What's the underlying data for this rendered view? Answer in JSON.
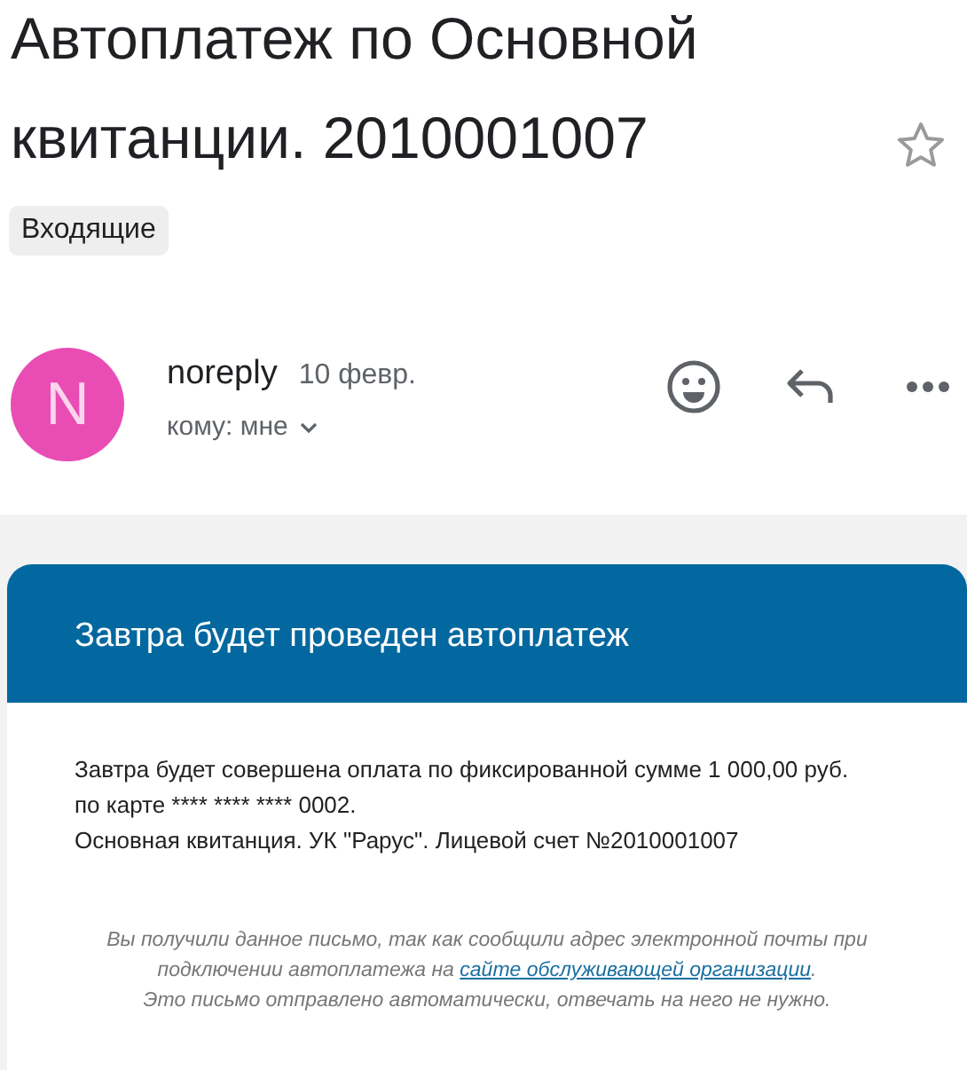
{
  "subject": "Автоплатеж по Основной квитанции. 2010001007",
  "starred": false,
  "label": "Входящие",
  "sender": {
    "avatar_letter": "N",
    "name": "noreply",
    "date": "10 февр.",
    "recipient": "кому: мне"
  },
  "message": {
    "header": "Завтра будет проведен автоплатеж",
    "lines": [
      "Завтра будет совершена оплата по фиксированной сумме 1 000,00 руб.",
      "по карте **** **** **** 0002.",
      "Основная квитанция. УК \"Рарус\". Лицевой счет №2010001007"
    ],
    "note_before": "Вы получили данное письмо, так как сообщили адрес электронной почты при подключении автоплатежа на ",
    "note_link": "сайте обслуживающей организации",
    "note_after": ".",
    "note_second": "Это письмо отправлено автоматически, отвечать на него не нужно."
  }
}
